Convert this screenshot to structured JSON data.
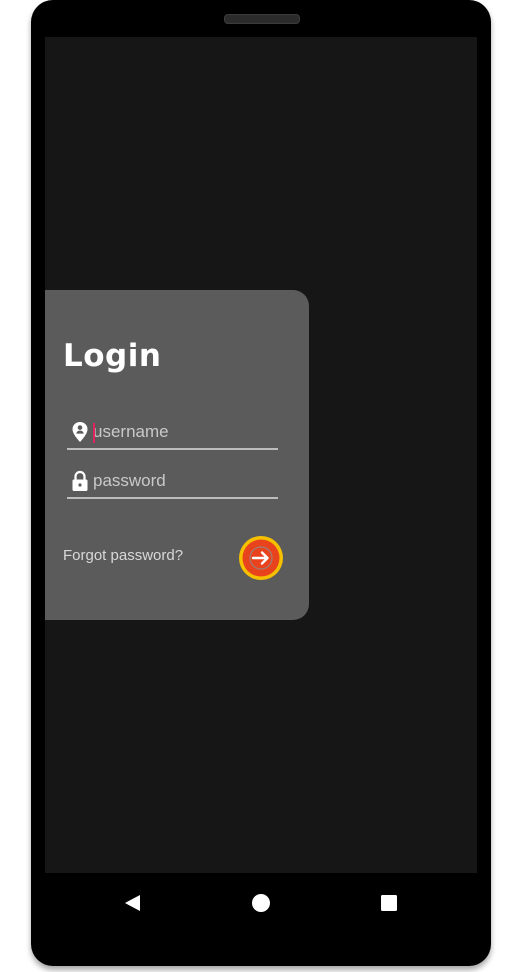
{
  "login": {
    "title": "Login",
    "username": {
      "value": "",
      "placeholder": "username",
      "icon": "location-pin-icon"
    },
    "password": {
      "value": "",
      "placeholder": "password",
      "icon": "lock-icon"
    },
    "forgot_label": "Forgot password?",
    "submit_icon": "arrow-right-icon"
  },
  "nav": {
    "back_icon": "back-triangle-icon",
    "home_icon": "home-circle-icon",
    "recents_icon": "recents-square-icon"
  },
  "colors": {
    "screen_bg": "#161616",
    "card_bg": "#5b5b5b",
    "accent_ring": "#f4c000",
    "accent_fill": "#e8431c",
    "caret": "#e0245e"
  }
}
